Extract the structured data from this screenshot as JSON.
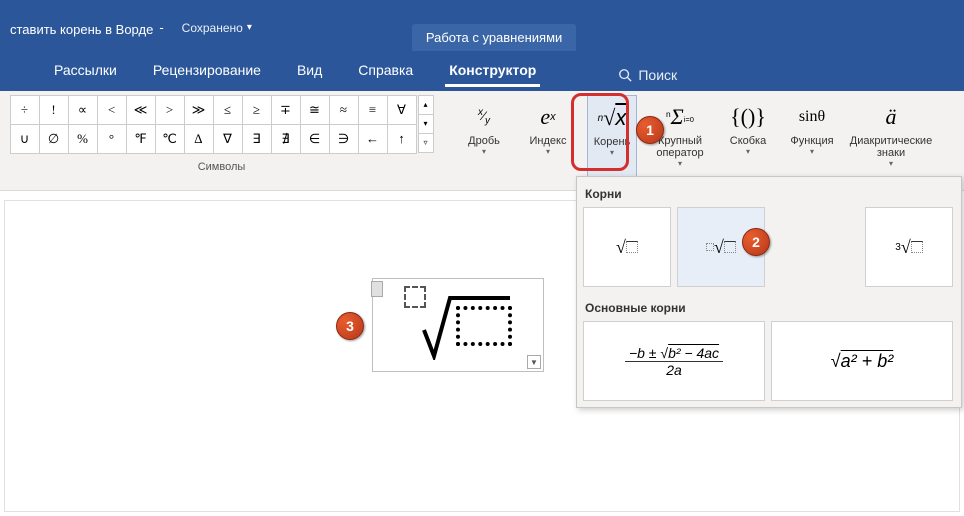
{
  "title": {
    "doc": "ставить корень в Ворде",
    "saved": "Сохранено",
    "tooltab": "Работа с уравнениями"
  },
  "tabs": {
    "t1": "Рассылки",
    "t2": "Рецензирование",
    "t3": "Вид",
    "t4": "Справка",
    "t5": "Конструктор",
    "search": "Поиск"
  },
  "symbols": {
    "r1": [
      "÷",
      "!",
      "∝",
      "<",
      "≪",
      ">",
      "≫",
      "≤",
      "≥",
      "∓",
      "≅",
      "≈",
      "≡",
      "∀"
    ],
    "r2": [
      "∪",
      "∅",
      "%",
      "°",
      "℉",
      "℃",
      "∆",
      "∇",
      "∃",
      "∄",
      "∈",
      "∋",
      "←",
      "↑"
    ],
    "label": "Символы"
  },
  "struct": {
    "frac": "Дробь",
    "index": "Индекс",
    "root": "Корень",
    "bigop": "Крупный оператор",
    "bracket": "Скобка",
    "func": "Функция",
    "accent": "Диакритические знаки"
  },
  "dropdown": {
    "sec1": "Корни",
    "sec2": "Основные корни",
    "quad": "−b ± √(b² − 4ac) / 2a",
    "pyth": "√(a² + b²)"
  },
  "badges": {
    "b1": "1",
    "b2": "2",
    "b3": "3"
  }
}
